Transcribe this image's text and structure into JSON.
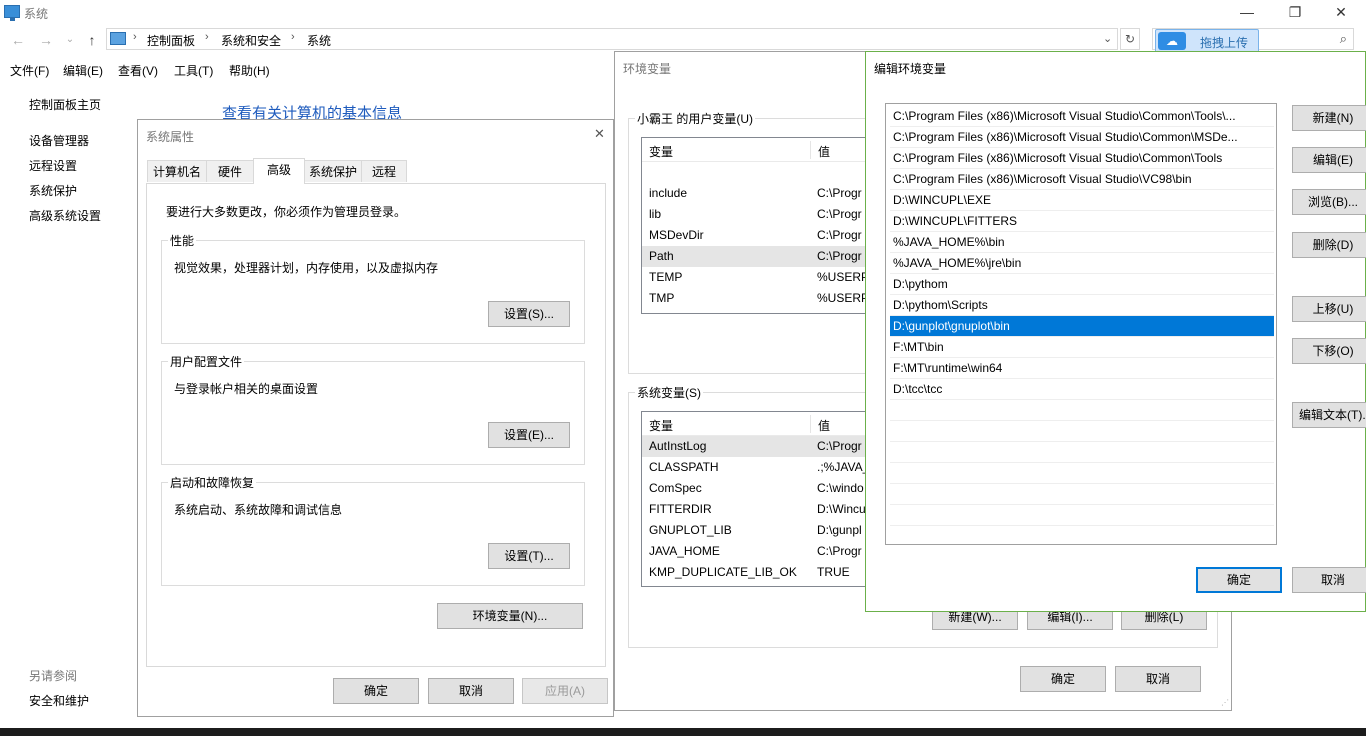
{
  "window": {
    "title": "系统",
    "controls": {
      "minimize": "—",
      "maximize": "❐",
      "close": "✕"
    }
  },
  "address": {
    "crumbs": [
      "控制面板",
      "系统和安全",
      "系统"
    ],
    "upload_label": "拖拽上传"
  },
  "menu": [
    "文件(F)",
    "编辑(E)",
    "查看(V)",
    "工具(T)",
    "帮助(H)"
  ],
  "sidebar": {
    "home": "控制面板主页",
    "links": [
      "设备管理器",
      "远程设置",
      "系统保护",
      "高级系统设置"
    ],
    "see_also": "另请参阅",
    "see_also_links": [
      "安全和维护"
    ]
  },
  "main": {
    "heading": "查看有关计算机的基本信息"
  },
  "sysprops": {
    "title": "系统属性",
    "close": "✕",
    "tabs": [
      "计算机名",
      "硬件",
      "高级",
      "系统保护",
      "远程"
    ],
    "active_tab": "高级",
    "admin_note": "要进行大多数更改，你必须作为管理员登录。",
    "performance": {
      "label": "性能",
      "desc": "视觉效果，处理器计划，内存使用，以及虚拟内存",
      "button": "设置(S)..."
    },
    "profile": {
      "label": "用户配置文件",
      "desc": "与登录帐户相关的桌面设置",
      "button": "设置(E)..."
    },
    "startup": {
      "label": "启动和故障恢复",
      "desc": "系统启动、系统故障和调试信息",
      "button": "设置(T)..."
    },
    "env_button": "环境变量(N)...",
    "ok": "确定",
    "cancel": "取消",
    "apply": "应用(A)"
  },
  "envvars": {
    "title": "环境变量",
    "user_label": "小霸王 的用户变量(U)",
    "sys_label": "系统变量(S)",
    "col_var": "变量",
    "col_val": "值",
    "user_rows": [
      {
        "name": "include",
        "value": "C:\\Progr"
      },
      {
        "name": "lib",
        "value": "C:\\Progr"
      },
      {
        "name": "MSDevDir",
        "value": "C:\\Progr"
      },
      {
        "name": "Path",
        "value": "C:\\Progr"
      },
      {
        "name": "TEMP",
        "value": "%USERP"
      },
      {
        "name": "TMP",
        "value": "%USERP"
      }
    ],
    "sys_rows": [
      {
        "name": "AutInstLog",
        "value": "C:\\Progr"
      },
      {
        "name": "CLASSPATH",
        "value": ".;%JAVA_"
      },
      {
        "name": "ComSpec",
        "value": "C:\\windo"
      },
      {
        "name": "FITTERDIR",
        "value": "D:\\Wincu"
      },
      {
        "name": "GNUPLOT_LIB",
        "value": "D:\\gunpl"
      },
      {
        "name": "JAVA_HOME",
        "value": "C:\\Progr"
      },
      {
        "name": "KMP_DUPLICATE_LIB_OK",
        "value": "TRUE"
      }
    ],
    "sys_new": "新建(W)...",
    "sys_edit": "编辑(I)...",
    "sys_delete": "删除(L)",
    "ok": "确定",
    "cancel": "取消"
  },
  "editenv": {
    "title": "编辑环境变量",
    "paths": [
      "C:\\Program Files (x86)\\Microsoft Visual Studio\\Common\\Tools\\...",
      "C:\\Program Files (x86)\\Microsoft Visual Studio\\Common\\MSDe...",
      "C:\\Program Files (x86)\\Microsoft Visual Studio\\Common\\Tools",
      "C:\\Program Files (x86)\\Microsoft Visual Studio\\VC98\\bin",
      "D:\\WINCUPL\\EXE",
      "D:\\WINCUPL\\FITTERS",
      "%JAVA_HOME%\\bin",
      "%JAVA_HOME%\\jre\\bin",
      "D:\\pythom",
      "D:\\pythom\\Scripts",
      "D:\\gunplot\\gnuplot\\bin",
      "F:\\MT\\bin",
      "F:\\MT\\runtime\\win64",
      "D:\\tcc\\tcc"
    ],
    "selected_index": 10,
    "buttons": {
      "new": "新建(N)",
      "edit": "编辑(E)",
      "browse": "浏览(B)...",
      "delete": "删除(D)",
      "up": "上移(U)",
      "down": "下移(O)",
      "edit_text": "编辑文本(T)..."
    },
    "ok": "确定",
    "cancel": "取消"
  }
}
